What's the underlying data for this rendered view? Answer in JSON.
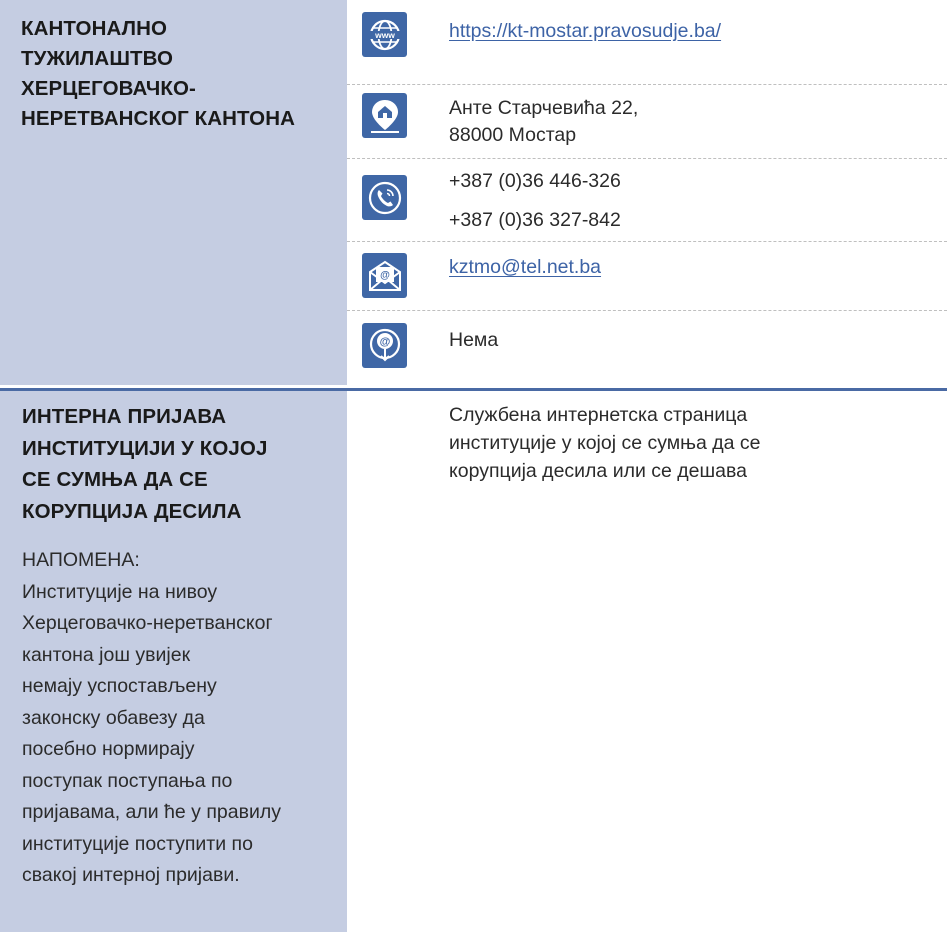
{
  "section1": {
    "title_lines": [
      "КАНТОНАЛНО",
      "ТУЖИЛАШТВО",
      "ХЕРЦЕГОВАЧКО-",
      "НЕРЕТВАНСКОГ КАНТОНА"
    ],
    "website": "https://kt-mostar.pravosudje.ba/",
    "address_line1": "Анте Старчевића 22,",
    "address_line2": "88000 Мостар",
    "phone1": "+387 (0)36 446-326",
    "phone2": "+387 (0)36 327-842",
    "email": "kztmo@tel.net.ba",
    "online": "Нема"
  },
  "section2": {
    "title_lines": [
      "ИНТЕРНА ПРИЈАВА",
      "ИНСТИТУЦИЈИ У КОЈОЈ",
      "СЕ СУМЊА ДА СЕ",
      "КОРУПЦИЈА ДЕСИЛА"
    ],
    "note_label": "НАПОМЕНА:",
    "note_lines": [
      "Институције на нивоу",
      "Херцеговачко-неретванског",
      "кантона још увијек",
      "немају успостављену",
      "законску обавезу да",
      "посебно нормирају",
      "поступак поступања по",
      "пријавама, али ће у правилу",
      "институције поступити по",
      "свакој интерној пријави."
    ],
    "description_lines": [
      "Службена интернетска страница",
      "институције у којој се сумња да се",
      "корупција десила или се дешава"
    ]
  },
  "icons": {
    "website": "www-globe-icon",
    "address": "location-pin-icon",
    "phone": "phone-icon",
    "email": "envelope-icon",
    "online": "online-report-icon"
  },
  "colors": {
    "panel": "#c5cde2",
    "icon_bg": "#3f67a6",
    "link": "#3d63a6",
    "divider": "#4a6aa4"
  }
}
